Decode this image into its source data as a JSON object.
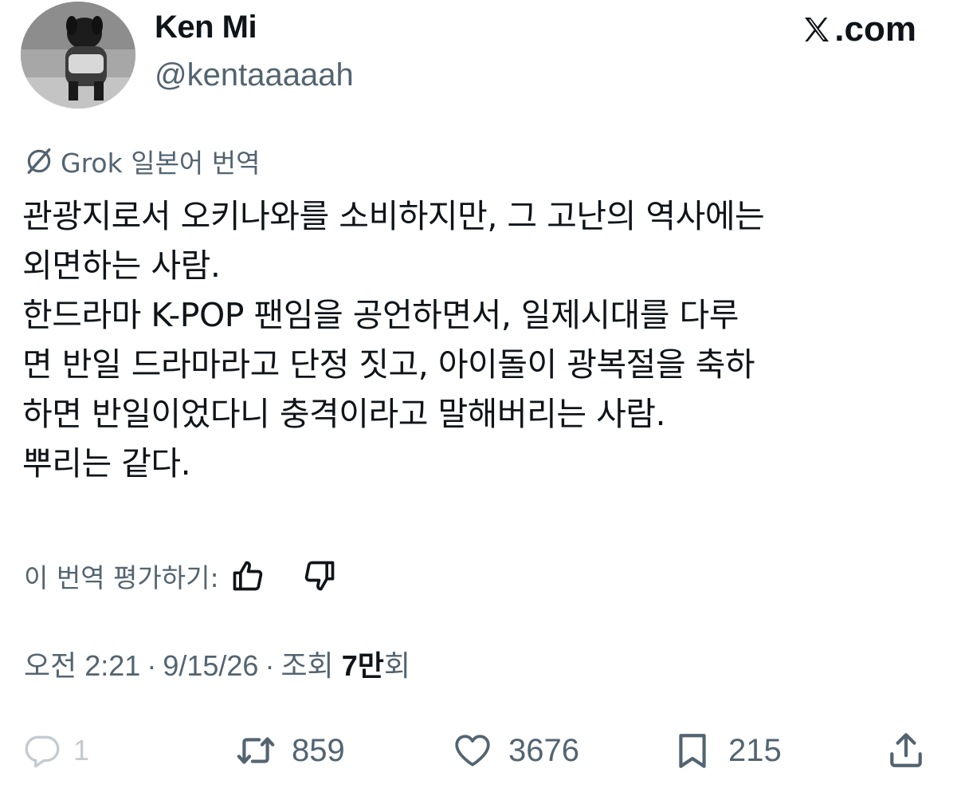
{
  "author": {
    "display_name": "Ken Mi",
    "handle": "@kentaaaaah"
  },
  "brand": {
    "text": ".com",
    "icon": "x-logo-icon"
  },
  "translation": {
    "label": "Grok 일본어 번역",
    "icon": "grok-icon"
  },
  "tweet": {
    "lines": [
      "관광지로서 오키나와를 소비하지만, 그 고난의 역사에는",
      "외면하는 사람.",
      "한드라마 K-POP 팬임을 공언하면서, 일제시대를 다루",
      "면 반일 드라마라고 단정 짓고, 아이돌이 광복절을 축하",
      "하면 반일이었다니 충격이라고 말해버리는 사람.",
      "뿌리는 같다."
    ]
  },
  "rating": {
    "label": "이 번역 평가하기:",
    "thumbs_up_icon": "thumbs-up-icon",
    "thumbs_down_icon": "thumbs-down-icon"
  },
  "meta": {
    "time": "오전 2:21",
    "separator": "·",
    "date": "9/15/26",
    "views_label": "조회",
    "views_count": "7만",
    "views_suffix": "회"
  },
  "actions": {
    "reply": {
      "count": "1",
      "icon": "reply-icon"
    },
    "retweet": {
      "count": "859",
      "icon": "retweet-icon"
    },
    "like": {
      "count": "3676",
      "icon": "heart-icon"
    },
    "bookmark": {
      "count": "215",
      "icon": "bookmark-icon"
    },
    "share": {
      "icon": "share-icon"
    }
  },
  "colors": {
    "text_primary": "#0f1419",
    "text_secondary": "#536471",
    "reply_muted": "#c3cbd1"
  }
}
